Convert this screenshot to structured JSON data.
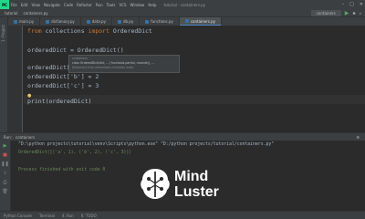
{
  "menubar": {
    "logo": "PC",
    "items": [
      "File",
      "Edit",
      "View",
      "Navigate",
      "Code",
      "Refactor",
      "Run",
      "Tools",
      "VCS",
      "Window",
      "Help"
    ],
    "title": "tutorial - containers.py"
  },
  "navbar": {
    "crumbs": [
      "tutorial",
      "containers.py"
    ],
    "run_config": "containers",
    "play": "▶"
  },
  "tabs": [
    {
      "label": "main.py",
      "active": false
    },
    {
      "label": "dictionary.py",
      "active": false
    },
    {
      "label": "data.py",
      "active": false
    },
    {
      "label": "db.py",
      "active": false
    },
    {
      "label": "functions.py",
      "active": false
    },
    {
      "label": "containers.py",
      "active": true
    }
  ],
  "left_tool": {
    "label": "1: Project"
  },
  "editor": {
    "lines": [
      {
        "kw1": "from",
        "t1": " collections ",
        "kw2": "import",
        "t2": " OrderedDict"
      },
      {
        "text": ""
      },
      {
        "text": "orderedDict = OrderedDict()"
      },
      {
        "text": ""
      },
      {
        "text": "orderedDict['a'] = 1"
      },
      {
        "text": "orderedDict['b'] = 2"
      },
      {
        "text": "orderedDict['c'] = 3"
      },
      {
        "text": ""
      },
      {
        "text": "print(orderedDict)"
      }
    ],
    "popup": {
      "line1": "containers",
      "line2": "class OrderedDict(dict, ...) functools.partial, module(), ...",
      "line3": "Dictionary that remembers insertion order"
    }
  },
  "run_panel": {
    "header": "Run:",
    "config": "containers",
    "console": [
      "\"D:\\python projects\\tutorial\\venv\\Scripts\\python.exe\" \"D:/python projects/tutorial/containers.py\"",
      "OrderedDict([('a', 1), ('b', 2), ('c', 3)])",
      "",
      "Process finished with exit code 0"
    ],
    "colors": {
      "path": "#a9b7c6",
      "output": "#6a8759",
      "process": "#a9b7c6"
    }
  },
  "statusbar": {
    "items": [
      "Python Console",
      "Terminal",
      "4: Run",
      "6: TODO"
    ]
  },
  "watermark": {
    "line1": "Mind",
    "line2": "Luster"
  }
}
